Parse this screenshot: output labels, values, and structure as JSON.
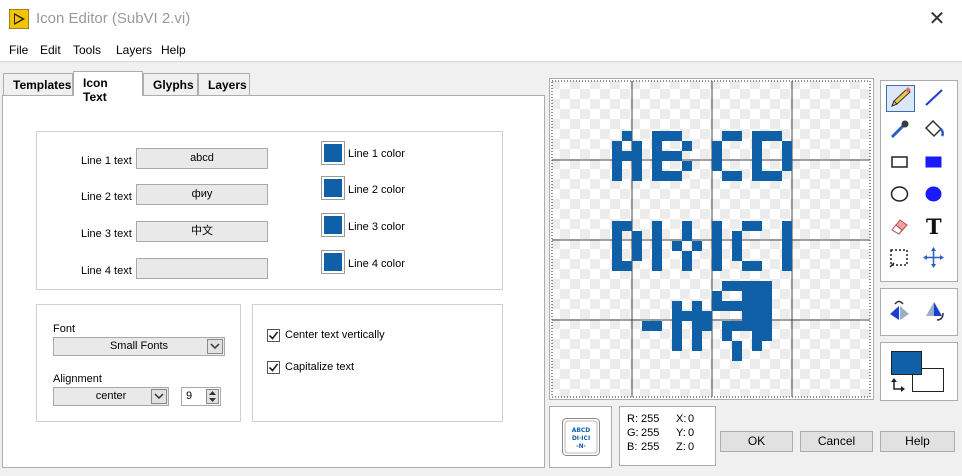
{
  "window": {
    "title": "Icon Editor (SubVI 2.vi)"
  },
  "menu": [
    "File",
    "Edit",
    "Tools",
    "Layers",
    "Help"
  ],
  "tabs": [
    "Templates",
    "Icon Text",
    "Glyphs",
    "Layers"
  ],
  "active_tab": "Icon Text",
  "icon_text": {
    "lines": [
      {
        "label": "Line 1 text",
        "value": "abcd",
        "color_label": "Line 1 color",
        "color": "#1060a8"
      },
      {
        "label": "Line 2 text",
        "value": "фиу",
        "color_label": "Line 2 color",
        "color": "#1060a8"
      },
      {
        "label": "Line 3 text",
        "value": "中文",
        "color_label": "Line 3 color",
        "color": "#1060a8"
      },
      {
        "label": "Line 4 text",
        "value": "",
        "color_label": "Line 4 color",
        "color": "#1060a8"
      }
    ],
    "font_label": "Font",
    "font_value": "Small Fonts",
    "alignment_label": "Alignment",
    "alignment_value": "center",
    "size_value": "9",
    "center_vertically_label": "Center text vertically",
    "center_vertically_checked": true,
    "capitalize_label": "Capitalize text",
    "capitalize_checked": true
  },
  "tools": [
    "pencil-icon",
    "line-icon",
    "dropper-icon",
    "fill-bucket-icon",
    "rectangle-icon",
    "filled-rectangle-icon",
    "ellipse-icon",
    "filled-ellipse-icon",
    "eraser-icon",
    "text-icon",
    "select-icon",
    "move-icon"
  ],
  "flip_tools": [
    "flip-horizontal-icon",
    "rotate-icon"
  ],
  "colors": {
    "foreground": "#1060a8",
    "background": "#ffffff",
    "accent": "#1060a8"
  },
  "info": {
    "r_label": "R:",
    "r": "255",
    "g_label": "G:",
    "g": "255",
    "b_label": "B:",
    "b": "255",
    "x_label": "X:",
    "x": "0",
    "y_label": "Y:",
    "y": "0",
    "z_label": "Z:",
    "z": "0"
  },
  "buttons": {
    "ok": "OK",
    "cancel": "Cancel",
    "help": "Help"
  }
}
